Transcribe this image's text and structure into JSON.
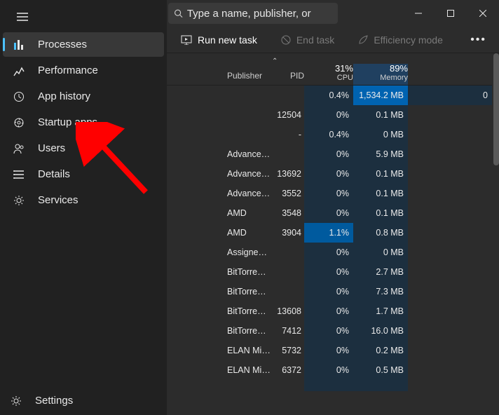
{
  "search": {
    "placeholder": "Type a name, publisher, or"
  },
  "toolbar": {
    "run_new_task": "Run new task",
    "end_task": "End task",
    "efficiency": "Efficiency mode"
  },
  "sidebar": {
    "items": [
      {
        "label": "Processes"
      },
      {
        "label": "Performance"
      },
      {
        "label": "App history"
      },
      {
        "label": "Startup apps"
      },
      {
        "label": "Users"
      },
      {
        "label": "Details"
      },
      {
        "label": "Services"
      }
    ],
    "settings": "Settings"
  },
  "columns": {
    "publisher": "Publisher",
    "pid": "PID",
    "cpu_pct": "31%",
    "cpu_label": "CPU",
    "mem_pct": "89%",
    "mem_label": "Memory"
  },
  "rows": [
    {
      "publisher": "",
      "pid": "",
      "cpu": "0.4%",
      "mem": "1,534.2 MB",
      "extra": "0",
      "hl_mem": true
    },
    {
      "publisher": "",
      "pid": "12504",
      "cpu": "0%",
      "mem": "0.1 MB"
    },
    {
      "publisher": "",
      "pid": "-",
      "cpu": "0.4%",
      "mem": "0 MB"
    },
    {
      "publisher": "Advanced Micro Device...",
      "pid": "",
      "cpu": "0%",
      "mem": "5.9 MB"
    },
    {
      "publisher": "Advanced Micro Device...",
      "pid": "13692",
      "cpu": "0%",
      "mem": "0.1 MB"
    },
    {
      "publisher": "Advanced Micro Device...",
      "pid": "3552",
      "cpu": "0%",
      "mem": "0.1 MB"
    },
    {
      "publisher": "AMD",
      "pid": "3548",
      "cpu": "0%",
      "mem": "0.1 MB"
    },
    {
      "publisher": "AMD",
      "pid": "3904",
      "cpu": "1.1%",
      "mem": "0.8 MB",
      "hl_cpu": true
    },
    {
      "publisher": "Assigned by your organi...",
      "pid": "",
      "cpu": "0%",
      "mem": "0 MB"
    },
    {
      "publisher": "BitTorrent Inc.",
      "pid": "",
      "cpu": "0%",
      "mem": "2.7 MB"
    },
    {
      "publisher": "BitTorrent Inc.",
      "pid": "",
      "cpu": "0%",
      "mem": "7.3 MB"
    },
    {
      "publisher": "BitTorrent Inc.",
      "pid": "13608",
      "cpu": "0%",
      "mem": "1.7 MB"
    },
    {
      "publisher": "BitTorrent Inc.",
      "pid": "7412",
      "cpu": "0%",
      "mem": "16.0 MB"
    },
    {
      "publisher": "ELAN Microelectronics ...",
      "pid": "5732",
      "cpu": "0%",
      "mem": "0.2 MB"
    },
    {
      "publisher": "ELAN Microelectronics ...",
      "pid": "6372",
      "cpu": "0%",
      "mem": "0.5 MB"
    },
    {
      "publisher": "",
      "pid": "",
      "cpu": "",
      "mem": ""
    }
  ]
}
